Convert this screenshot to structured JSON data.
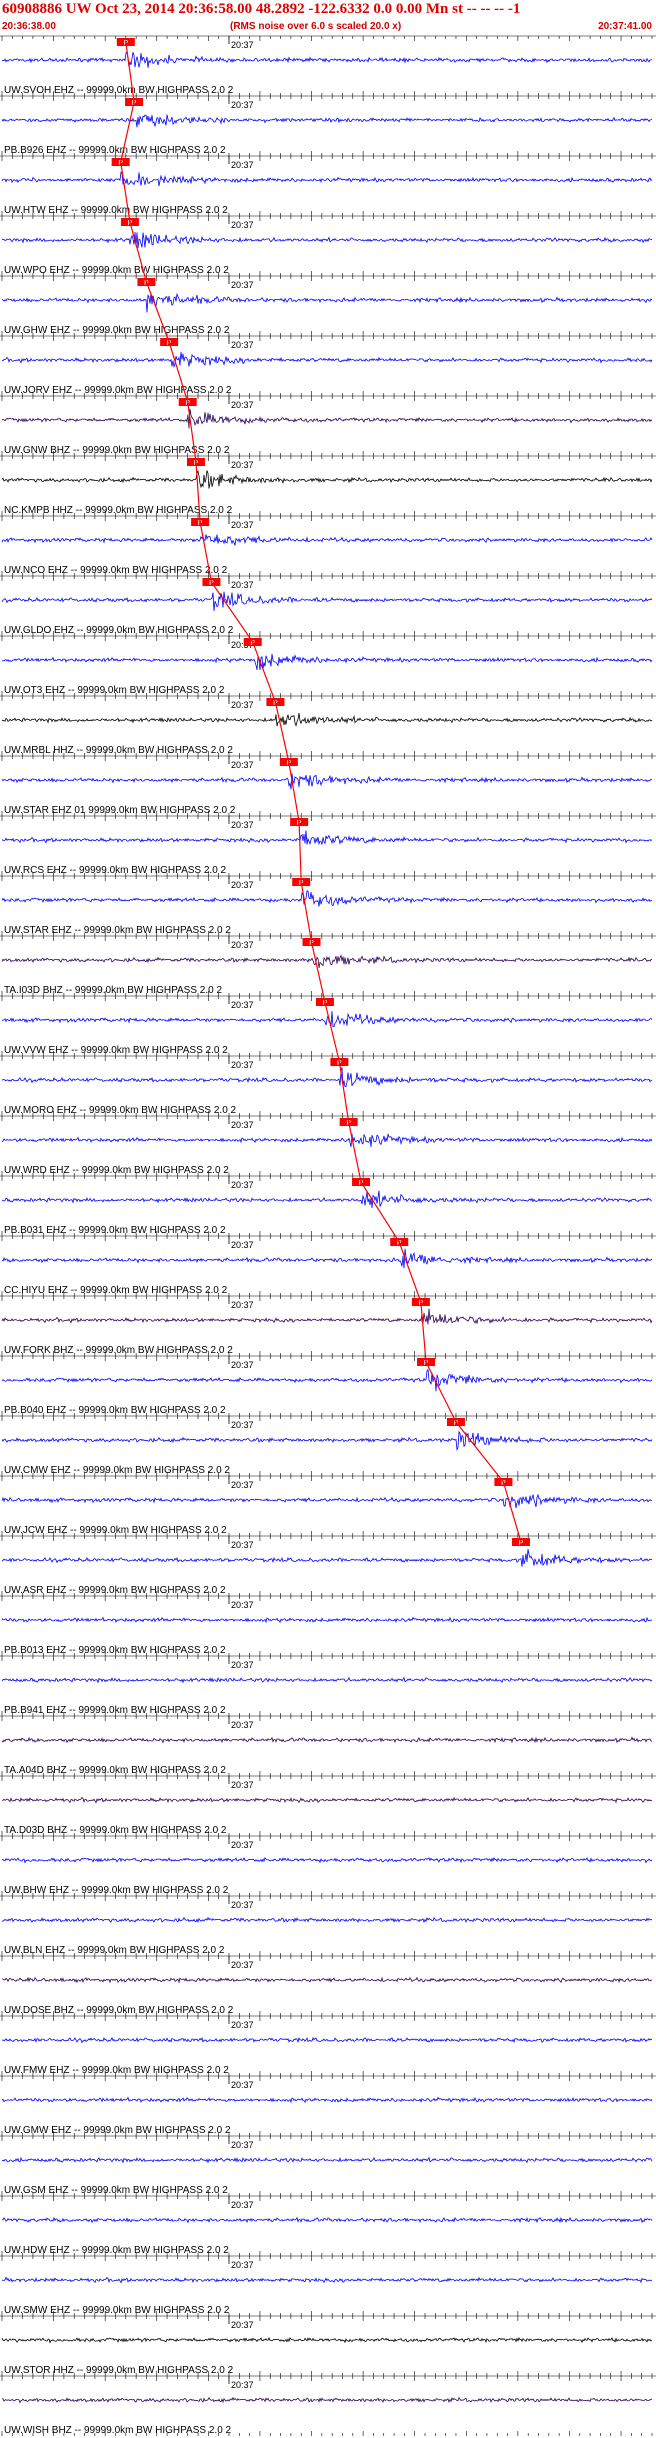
{
  "header": {
    "title": "60908886 UW Oct 23, 2014 20:36:58.00   48.2892 -122.6332  0.0 0.00 Mn st -- -- --  -1",
    "start_time": "20:36:38.00",
    "end_time": "20:37:41.00",
    "note": "(RMS noise over 6.0 s scaled 20.0 x)"
  },
  "chart_data": {
    "type": "line",
    "title": "60908886 UW Oct 23, 2014 20:36:58.00   48.2892 -122.6332  0.0 0.00 Mn st -- -- --  -1",
    "x_range": [
      "20:36:38.00",
      "20:37:41.00"
    ],
    "minute_label": "20:37",
    "pick_marker_label": "P",
    "colors": {
      "trace_blue": "#0000ff",
      "trace_black": "#000000",
      "trace_purple": "#2a005a",
      "pick": "#ff0000",
      "header_red": "#e00000"
    },
    "traces": [
      {
        "label": "UW.SVOH EHZ -- 99999.0km BW  HIGHPASS  2.0  2",
        "color": "#0000ff",
        "pick_s": 12.0
      },
      {
        "label": "PB.B926 EHZ -- 99999.0km BW  HIGHPASS  2.0  2",
        "color": "#0000ff",
        "pick_s": 12.8
      },
      {
        "label": "UW.HTW EHZ -- 99999.0km BW  HIGHPASS  2.0  2",
        "color": "#0000ff",
        "pick_s": 11.5
      },
      {
        "label": "UW.WPO EHZ -- 99999.0km BW  HIGHPASS  2.0  2",
        "color": "#0000ff",
        "pick_s": 12.4
      },
      {
        "label": "UW.GHW EHZ -- 99999.0km BW  HIGHPASS  2.0  2",
        "color": "#0000ff",
        "pick_s": 14.0
      },
      {
        "label": "UW.JORV EHZ -- 99999.0km BW  HIGHPASS  2.0  2",
        "color": "#0000ff",
        "pick_s": 16.2
      },
      {
        "label": "UW.GNW BHZ -- 99999.0km BW  HIGHPASS  2.0  2",
        "color": "#2a005a",
        "pick_s": 18.0
      },
      {
        "label": "NC.KMPB HHZ -- 99999.0km BW  HIGHPASS  2.0  2",
        "color": "#000000",
        "pick_s": 18.8
      },
      {
        "label": "UW.NCO EHZ -- 99999.0km BW  HIGHPASS  2.0  2",
        "color": "#0000ff",
        "pick_s": 19.2
      },
      {
        "label": "UW.GLDO EHZ -- 99999.0km BW  HIGHPASS  2.0  2",
        "color": "#0000ff",
        "pick_s": 20.3
      },
      {
        "label": "UW.OT3 EHZ -- 99999.0km BW  HIGHPASS  2.0  2",
        "color": "#0000ff",
        "pick_s": 24.3
      },
      {
        "label": "UW.MRBL HHZ -- 99999.0km BW  HIGHPASS  2.0  2",
        "color": "#000000",
        "pick_s": 26.5
      },
      {
        "label": "UW.STAR EHZ 01 99999.0km BW  HIGHPASS  2.0  2",
        "color": "#0000ff",
        "pick_s": 27.8
      },
      {
        "label": "UW.RCS EHZ -- 99999.0km BW  HIGHPASS  2.0  2",
        "color": "#0000ff",
        "pick_s": 28.8
      },
      {
        "label": "UW.STAR EHZ -- 99999.0km BW  HIGHPASS  2.0  2",
        "color": "#0000ff",
        "pick_s": 29.0
      },
      {
        "label": "TA.I03D BHZ -- 99999.0km BW  HIGHPASS  2.0  2",
        "color": "#2a005a",
        "pick_s": 30.0
      },
      {
        "label": "UW.VVW EHZ -- 99999.0km BW  HIGHPASS  2.0  2",
        "color": "#0000ff",
        "pick_s": 31.3
      },
      {
        "label": "UW.MORO EHZ -- 99999.0km BW  HIGHPASS  2.0  2",
        "color": "#0000ff",
        "pick_s": 32.7
      },
      {
        "label": "UW.WRD EHZ -- 99999.0km BW  HIGHPASS  2.0  2",
        "color": "#0000ff",
        "pick_s": 33.6
      },
      {
        "label": "PB.B031 EHZ -- 99999.0km BW  HIGHPASS  2.0  2",
        "color": "#0000ff",
        "pick_s": 34.8
      },
      {
        "label": "CC.HIYU EHZ -- 99999.0km BW  HIGHPASS  2.0  2",
        "color": "#0000ff",
        "pick_s": 38.5
      },
      {
        "label": "UW.FORK BHZ -- 99999.0km BW  HIGHPASS  2.0  2",
        "color": "#2a005a",
        "pick_s": 40.6
      },
      {
        "label": "PB.B040 EHZ -- 99999.0km BW  HIGHPASS  2.0  2",
        "color": "#0000ff",
        "pick_s": 41.1
      },
      {
        "label": "UW.CMW EHZ -- 99999.0km BW  HIGHPASS  2.0  2",
        "color": "#0000ff",
        "pick_s": 44.0
      },
      {
        "label": "UW.JCW EHZ -- 99999.0km BW  HIGHPASS  2.0  2",
        "color": "#0000ff",
        "pick_s": 48.6
      },
      {
        "label": "UW.ASR EHZ -- 99999.0km BW  HIGHPASS  2.0  2",
        "color": "#0000ff",
        "pick_s": 50.3
      },
      {
        "label": "PB.B013 EHZ -- 99999.0km BW  HIGHPASS  2.0  2",
        "color": "#0000ff",
        "pick_s": null
      },
      {
        "label": "PB.B941 EHZ -- 99999.0km BW  HIGHPASS  2.0  2",
        "color": "#0000ff",
        "pick_s": null
      },
      {
        "label": "TA.A04D BHZ -- 99999.0km BW  HIGHPASS  2.0  2",
        "color": "#2a005a",
        "pick_s": null
      },
      {
        "label": "TA.D03D BHZ -- 99999.0km BW  HIGHPASS  2.0  2",
        "color": "#2a005a",
        "pick_s": null
      },
      {
        "label": "UW.BHW EHZ -- 99999.0km BW  HIGHPASS  2.0  2",
        "color": "#0000ff",
        "pick_s": null
      },
      {
        "label": "UW.BLN EHZ -- 99999.0km BW  HIGHPASS  2.0  2",
        "color": "#0000ff",
        "pick_s": null
      },
      {
        "label": "UW.DOSE BHZ -- 99999.0km BW  HIGHPASS  2.0  2",
        "color": "#2a005a",
        "pick_s": null
      },
      {
        "label": "UW.FMW EHZ -- 99999.0km BW  HIGHPASS  2.0  2",
        "color": "#0000ff",
        "pick_s": null
      },
      {
        "label": "UW.GMW EHZ -- 99999.0km BW  HIGHPASS  2.0  2",
        "color": "#0000ff",
        "pick_s": null
      },
      {
        "label": "UW.GSM EHZ -- 99999.0km BW  HIGHPASS  2.0  2",
        "color": "#0000ff",
        "pick_s": null
      },
      {
        "label": "UW.HDW EHZ -- 99999.0km BW  HIGHPASS  2.0  2",
        "color": "#0000ff",
        "pick_s": null
      },
      {
        "label": "UW.SMW EHZ -- 99999.0km BW  HIGHPASS  2.0  2",
        "color": "#0000ff",
        "pick_s": null
      },
      {
        "label": "UW.STOR HHZ -- 99999.0km BW  HIGHPASS  2.0  2",
        "color": "#000000",
        "pick_s": null
      },
      {
        "label": "UW.WISH BHZ -- 99999.0km BW  HIGHPASS  2.0  2",
        "color": "#2a005a",
        "pick_s": null
      }
    ]
  }
}
